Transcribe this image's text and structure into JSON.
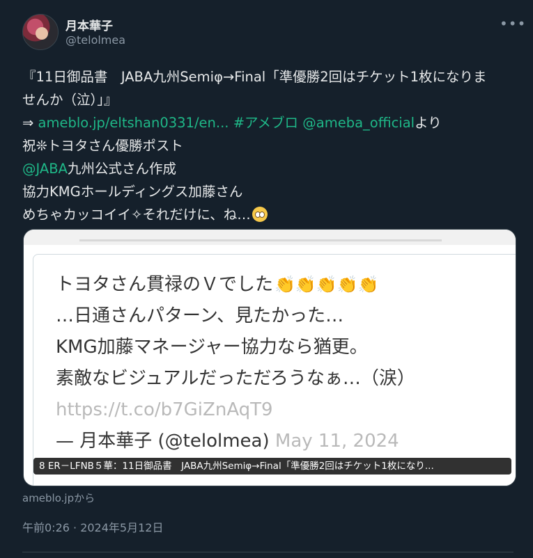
{
  "author": {
    "name": "月本華子",
    "handle": "@telolmea"
  },
  "more_icon": "•••",
  "post": {
    "line1": "『11日御品書　JABA九州Semiφ→Final「準優勝2回はチケット1枚になりま",
    "line2": "せんか（泣）」』",
    "line3_arrow": "⇒ ",
    "line3_link": "ameblo.jp/eltshan0331/en...",
    "line3_tag": "#アメブロ",
    "line3_mention": "@ameba_official",
    "line3_tail": "より",
    "line4": "祝❊トヨタさん優勝ポスト",
    "line5_mention": "@JABA",
    "line5_tail": "九州公式さん作成",
    "line6": "協力KMGホールディングス加藤さん",
    "line7": "めちゃカッコイイ✧それだけに、ね…"
  },
  "card": {
    "quote_line1": "トヨタさん貫禄のＶでした",
    "quote_line2": "…日通さんパターン、見たかった…",
    "quote_line3": "KMG加藤マネージャー協力なら猶更。",
    "quote_line4": "素敵なビジュアルだっただろうなぁ…（涙）",
    "quote_url": "https://t.co/b7GiZnAqT9",
    "quote_author": "— 月本華子 (@telolmea)",
    "quote_date": "May 11, 2024",
    "overlay_title": "8 ER－LFNB５華：11日御品書　JABA九州Semiφ→Final「準優勝2回はチケット1枚になり..."
  },
  "source": "ameblo.jpから",
  "timestamp": "午前0:26 · 2024年5月12日",
  "colors": {
    "background": "#15202b",
    "link": "#1fb888",
    "muted": "#8b98a5"
  }
}
